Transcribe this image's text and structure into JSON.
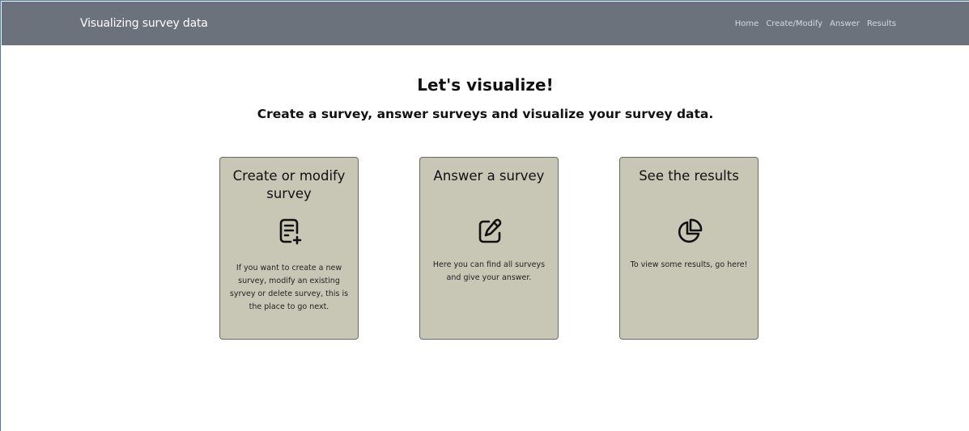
{
  "navbar": {
    "brand": "Visualizing survey data",
    "links": [
      "Home",
      "Create/Modify",
      "Answer",
      "Results"
    ]
  },
  "hero": {
    "title": "Let's visualize!",
    "subtitle": "Create a survey, answer surveys and visualize your survey data."
  },
  "cards": [
    {
      "title": "Create or modify survey",
      "icon": "document-plus-icon",
      "text": "If you want to create a new survey, modify an existing syrvey or delete survey, this is the place to go next."
    },
    {
      "title": "Answer a survey",
      "icon": "edit-icon",
      "text": "Here you can find all surveys and give your answer."
    },
    {
      "title": "See the results",
      "icon": "pie-chart-icon",
      "text": "To view some results, go here!"
    }
  ],
  "colors": {
    "navbar": "#6b727c",
    "card_bg": "#c8c7b6",
    "card_border": "#6a6a60"
  }
}
